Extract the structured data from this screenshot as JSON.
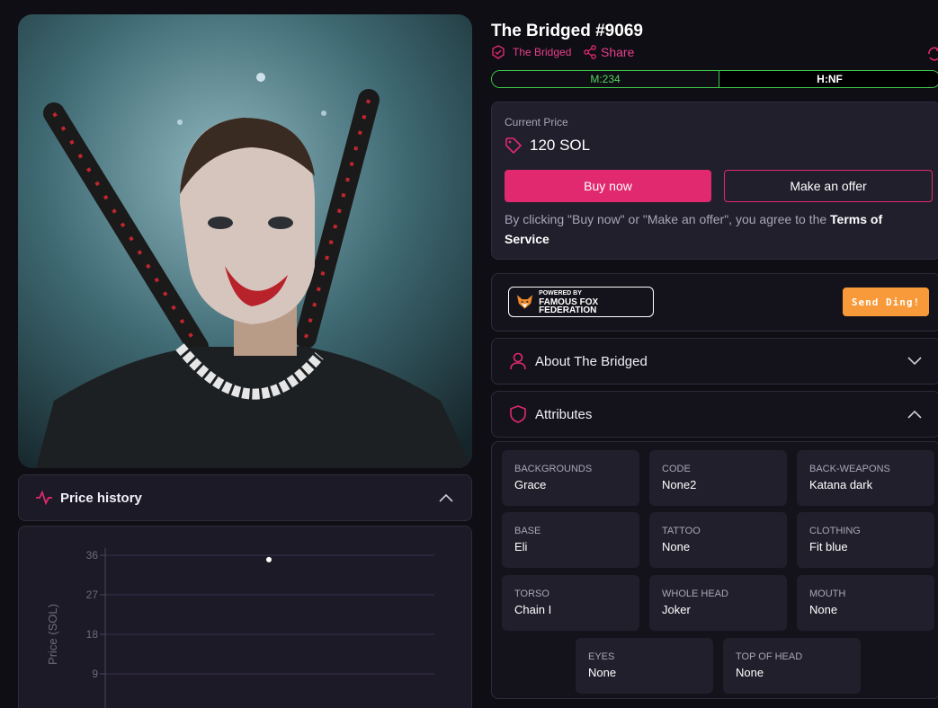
{
  "nft": {
    "title": "The Bridged #9069",
    "collection": "The Bridged",
    "share_label": "Share",
    "rank_m": "M:234",
    "rank_h": "H:NF"
  },
  "price_card": {
    "current_price_label": "Current Price",
    "price": "120 SOL",
    "buy_label": "Buy now",
    "offer_label": "Make an offer",
    "tos_prefix": "By clicking \"Buy now\" or \"Make an offer\", you agree to the ",
    "tos_link": "Terms of Service"
  },
  "promo": {
    "powered_by": "POWERED BY",
    "brand": "FAMOUS FOX FEDERATION",
    "ding_label": "Send Ding!"
  },
  "sections": {
    "about_label": "About The Bridged",
    "attributes_label": "Attributes",
    "price_history_label": "Price history"
  },
  "attributes": [
    {
      "key": "BACKGROUNDS",
      "value": "Grace"
    },
    {
      "key": "CODE",
      "value": "None2"
    },
    {
      "key": "BACK-WEAPONS",
      "value": "Katana dark"
    },
    {
      "key": "BASE",
      "value": "Eli"
    },
    {
      "key": "TATTOO",
      "value": "None"
    },
    {
      "key": "CLOTHING",
      "value": "Fit blue"
    },
    {
      "key": "TORSO",
      "value": "Chain I"
    },
    {
      "key": "WHOLE HEAD",
      "value": "Joker"
    },
    {
      "key": "MOUTH",
      "value": "None"
    },
    {
      "key": "EYES",
      "value": "None"
    },
    {
      "key": "TOP OF HEAD",
      "value": "None"
    }
  ],
  "chart_data": {
    "type": "scatter",
    "title": "",
    "ylabel": "Price (SOL)",
    "yticks": [
      36,
      27,
      18,
      9
    ],
    "ylim": [
      0,
      36
    ],
    "points": [
      {
        "y": 35
      }
    ],
    "grid": true
  },
  "colors": {
    "accent": "#e1296f",
    "rank_green": "#52d65e",
    "ding_orange": "#f89a3a",
    "background": "#0f0e14"
  }
}
